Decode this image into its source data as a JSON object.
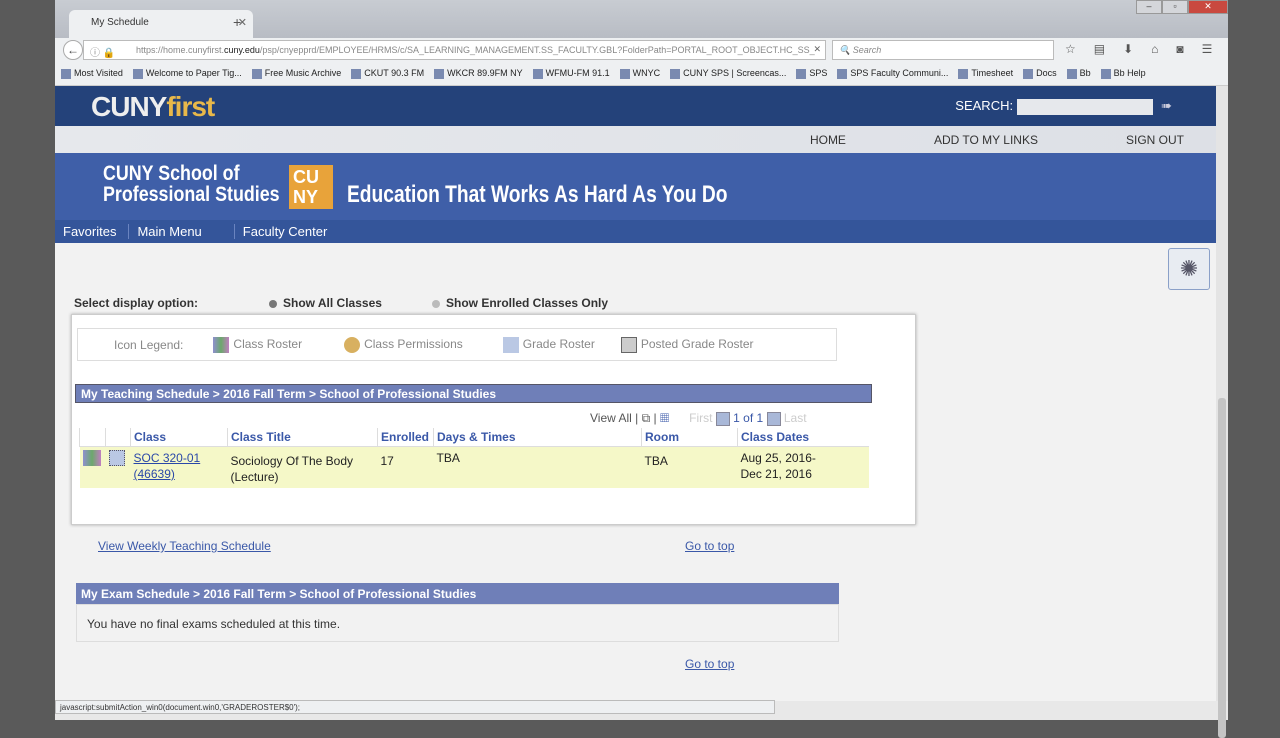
{
  "browser": {
    "tab_title": "My Schedule",
    "url_prefix": "https://home.cunyfirst.",
    "url_domain": "cuny.edu",
    "url_rest": "/psp/cnyepprd/EMPLOYEE/HRMS/c/SA_LEARNING_MANAGEMENT.SS_FACULTY.GBL?FolderPath=PORTAL_ROOT_OBJECT.HC_SS_",
    "search_placeholder": "Search",
    "bookmarks": [
      "Most Visited",
      "Welcome to Paper Tig...",
      "Free Music Archive",
      "CKUT 90.3 FM",
      "WKCR 89.9FM NY",
      "WFMU-FM 91.1",
      "WNYC",
      "CUNY SPS | Screencas...",
      "SPS",
      "SPS Faculty Communi...",
      "Timesheet",
      "Docs",
      "Bb",
      "Bb Help"
    ],
    "status": "javascript:submitAction_win0(document.win0,'GRADEROSTER$0');"
  },
  "header": {
    "logo_main": "CUNY",
    "logo_accent": "first",
    "search_label": "SEARCH:",
    "links": [
      "HOME",
      "ADD TO MY LINKS",
      "SIGN OUT"
    ]
  },
  "banner": {
    "school_line1": "CUNY School of",
    "school_line2": "Professional Studies",
    "badge1": "CU",
    "badge2": "NY",
    "tagline": "Education That Works As Hard As You Do"
  },
  "menu": [
    "Favorites",
    "Main Menu",
    "Faculty Center"
  ],
  "display": {
    "label": "Select display option:",
    "opt1": "Show All Classes",
    "opt2": "Show Enrolled Classes Only",
    "selected": "Show All Classes"
  },
  "legend": {
    "label": "Icon Legend:",
    "items": [
      "Class Roster",
      "Class Permissions",
      "Grade Roster",
      "Posted Grade Roster"
    ]
  },
  "teaching": {
    "title": "My Teaching Schedule > 2016 Fall Term > School of Professional Studies",
    "view_all": "View All",
    "first": "First",
    "page": "1 of 1",
    "last": "Last",
    "columns": [
      "Class",
      "Class Title",
      "Enrolled",
      "Days & Times",
      "Room",
      "Class Dates"
    ],
    "rows": [
      {
        "class": "SOC 320-01",
        "class_nbr": "(46639)",
        "title1": "Sociology Of The Body",
        "title2": "(Lecture)",
        "enrolled": "17",
        "days": "TBA",
        "room": "TBA",
        "dates1": "Aug 25, 2016-",
        "dates2": "Dec 21, 2016"
      }
    ]
  },
  "links": {
    "weekly": "View Weekly Teaching Schedule",
    "top": "Go to top"
  },
  "exam": {
    "title": "My Exam Schedule > 2016 Fall Term > School of Professional Studies",
    "message": "You have no final exams scheduled at this time."
  }
}
